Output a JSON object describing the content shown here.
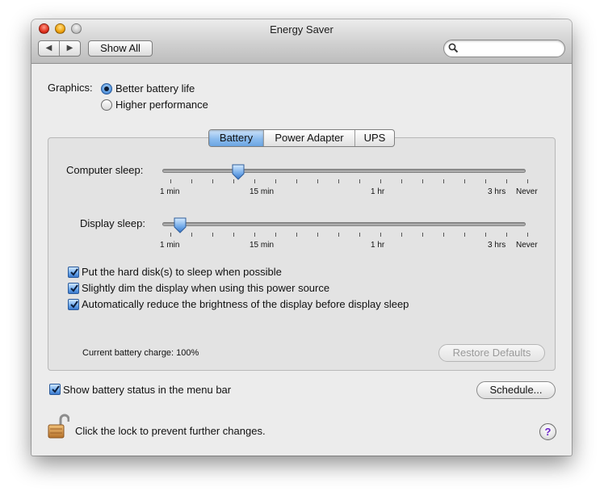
{
  "window": {
    "title": "Energy Saver"
  },
  "toolbar": {
    "back_glyph": "◀",
    "forward_glyph": "▶",
    "show_all_label": "Show All",
    "search_value": "",
    "search_icon": "search-icon"
  },
  "graphics": {
    "label": "Graphics:",
    "options": [
      {
        "label": "Better battery life",
        "selected": true
      },
      {
        "label": "Higher performance",
        "selected": false
      }
    ]
  },
  "tabs": [
    {
      "label": "Battery",
      "selected": true
    },
    {
      "label": "Power Adapter",
      "selected": false
    },
    {
      "label": "UPS",
      "selected": false
    }
  ],
  "sliders": {
    "computer_sleep": {
      "label": "Computer sleep:",
      "value_minutes": 15
    },
    "display_sleep": {
      "label": "Display sleep:",
      "value_minutes": 2
    },
    "tick_labels": [
      "1 min",
      "15 min",
      "1 hr",
      "3 hrs",
      "Never"
    ]
  },
  "checkboxes": [
    {
      "label": "Put the hard disk(s) to sleep when possible",
      "checked": true
    },
    {
      "label": "Slightly dim the display when using this power source",
      "checked": true
    },
    {
      "label": "Automatically reduce the brightness of the display before display sleep",
      "checked": true
    }
  ],
  "status": {
    "battery_charge_text": "Current battery charge: 100%"
  },
  "buttons": {
    "restore_defaults": "Restore Defaults",
    "schedule": "Schedule..."
  },
  "menubar_checkbox": {
    "label": "Show battery status in the menu bar",
    "checked": true
  },
  "lock": {
    "text": "Click the lock to prevent further changes.",
    "icon": "padlock-open-icon"
  },
  "help": {
    "label": "?"
  },
  "colors": {
    "accent": "#5b9be0",
    "help_glyph": "#6a21c8"
  }
}
